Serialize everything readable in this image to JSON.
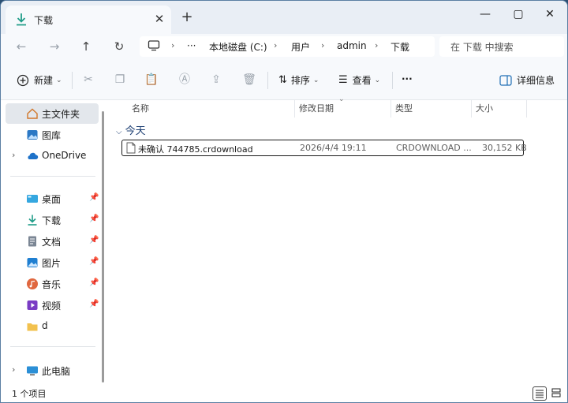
{
  "window": {
    "tab_title": "下载",
    "new_tab_icon": "plus-icon",
    "minimize_icon": "minimize-icon",
    "maximize_icon": "maximize-icon",
    "close_icon": "close-icon"
  },
  "nav": {
    "more": "···",
    "breadcrumbs": [
      "本地磁盘 (C:)",
      "用户",
      "admin",
      "下载"
    ],
    "search_placeholder": "在 下载 中搜索"
  },
  "toolbar": {
    "new_label": "新建",
    "sort_label": "排序",
    "view_label": "查看",
    "more_label": "···",
    "details_label": "详细信息"
  },
  "sidebar": {
    "items": [
      {
        "label": "主文件夹",
        "icon": "home-icon",
        "selected": true
      },
      {
        "label": "图库",
        "icon": "gallery-icon"
      },
      {
        "label": "OneDrive",
        "icon": "cloud-icon",
        "expandable": true
      },
      {
        "label": "桌面",
        "icon": "desktop-icon",
        "pinned": true
      },
      {
        "label": "下载",
        "icon": "download-icon",
        "pinned": true
      },
      {
        "label": "文档",
        "icon": "document-icon",
        "pinned": true
      },
      {
        "label": "图片",
        "icon": "pictures-icon",
        "pinned": true
      },
      {
        "label": "音乐",
        "icon": "music-icon",
        "pinned": true
      },
      {
        "label": "视频",
        "icon": "video-icon",
        "pinned": true
      },
      {
        "label": "d",
        "icon": "folder-icon"
      },
      {
        "label": "此电脑",
        "icon": "this-pc-icon",
        "expandable": true
      }
    ]
  },
  "list": {
    "columns": [
      "名称",
      "修改日期",
      "类型",
      "大小"
    ],
    "group_label": "今天",
    "rows": [
      {
        "name": "未确认 744785.crdownload",
        "modified": "2026/4/4 19:11",
        "type": "CRDOWNLOAD ...",
        "size": "30,152 KB"
      }
    ]
  },
  "status": {
    "item_count": "1 个项目"
  },
  "colors": {
    "accent": "#1d3f73",
    "selected_bg": "#e3e7ec",
    "chrome_bg": "#f7f9fc",
    "titlebar_bg": "#e9eef5"
  }
}
